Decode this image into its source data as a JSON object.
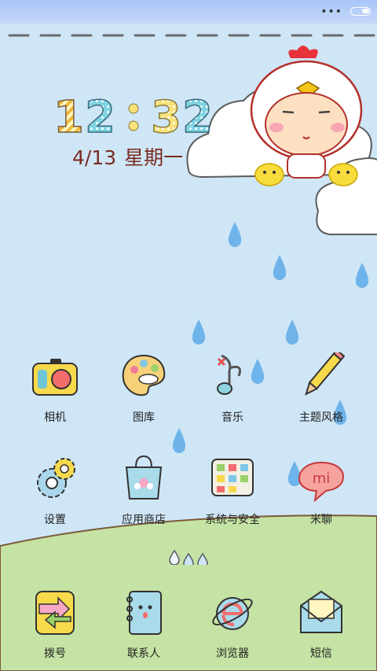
{
  "status_bar": {
    "menu_icon": "more-dots-icon",
    "battery_icon": "battery-icon"
  },
  "clock": {
    "h1": "1",
    "h2": "2",
    "m1": "3",
    "m2": "2"
  },
  "date": {
    "day": "4/13",
    "weekday": "星期一"
  },
  "apps": [
    {
      "label": "相机",
      "icon": "camera-icon"
    },
    {
      "label": "图库",
      "icon": "palette-icon"
    },
    {
      "label": "音乐",
      "icon": "music-note-icon"
    },
    {
      "label": "主题风格",
      "icon": "pencil-icon"
    },
    {
      "label": "设置",
      "icon": "gear-icon"
    },
    {
      "label": "应用商店",
      "icon": "shopping-bag-icon"
    },
    {
      "label": "系统与安全",
      "icon": "shield-grid-icon"
    },
    {
      "label": "米聊",
      "icon": "speech-bubble-icon"
    }
  ],
  "dock": [
    {
      "label": "拨号",
      "icon": "phone-icon"
    },
    {
      "label": "联系人",
      "icon": "contacts-book-icon"
    },
    {
      "label": "浏览器",
      "icon": "browser-icon"
    },
    {
      "label": "短信",
      "icon": "envelope-icon"
    }
  ],
  "bubble_text": "mi",
  "pager": {
    "count": 3,
    "active": 1
  }
}
